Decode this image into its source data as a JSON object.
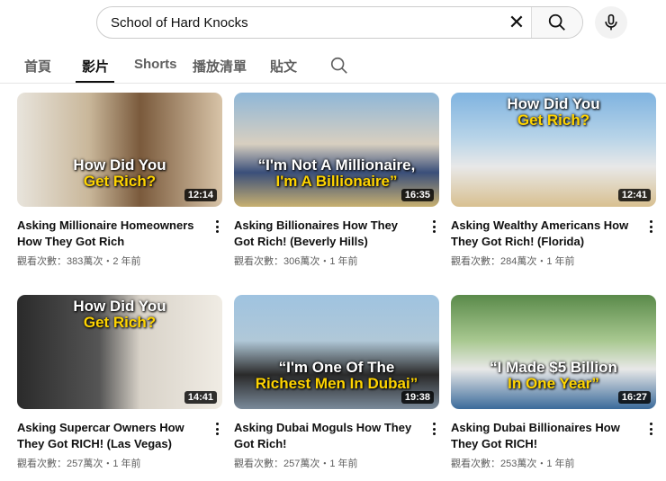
{
  "search": {
    "query": "School of Hard Knocks"
  },
  "tabs": [
    {
      "label": "首頁"
    },
    {
      "label": "影片",
      "active": true
    },
    {
      "label": "Shorts"
    },
    {
      "label": "播放清單"
    },
    {
      "label": "貼文"
    }
  ],
  "videos": [
    {
      "title": "Asking Millionaire Homeowners How They Got Rich",
      "meta": "觀看次數：383萬次・2 年前",
      "duration": "12:14",
      "overlay_line1": "How Did You",
      "overlay_line2": "Get Rich?"
    },
    {
      "title": "Asking Billionaires How They Got Rich! (Beverly Hills)",
      "meta": "觀看次數：306萬次・1 年前",
      "duration": "16:35",
      "overlay_line1": "“I'm Not A Millionaire,",
      "overlay_line2": "I'm A Billionaire”"
    },
    {
      "title": "Asking Wealthy Americans How They Got Rich! (Florida)",
      "meta": "觀看次數：284萬次・1 年前",
      "duration": "12:41",
      "overlay_line1": "How Did You",
      "overlay_line2": "Get Rich?"
    },
    {
      "title": "Asking Supercar Owners How They Got RICH! (Las Vegas)",
      "meta": "觀看次數：257萬次・1 年前",
      "duration": "14:41",
      "overlay_line1": "How Did You",
      "overlay_line2": "Get Rich?"
    },
    {
      "title": "Asking Dubai Moguls How They Got Rich!",
      "meta": "觀看次數：257萬次・1 年前",
      "duration": "19:38",
      "overlay_line1": "“I'm One Of The",
      "overlay_line2": "Richest Men In Dubai”"
    },
    {
      "title": "Asking Dubai Billionaires How They Got RICH!",
      "meta": "觀看次數：253萬次・1 年前",
      "duration": "16:27",
      "overlay_line1": "“I Made $5 Billion",
      "overlay_line2": "In One Year”"
    }
  ]
}
